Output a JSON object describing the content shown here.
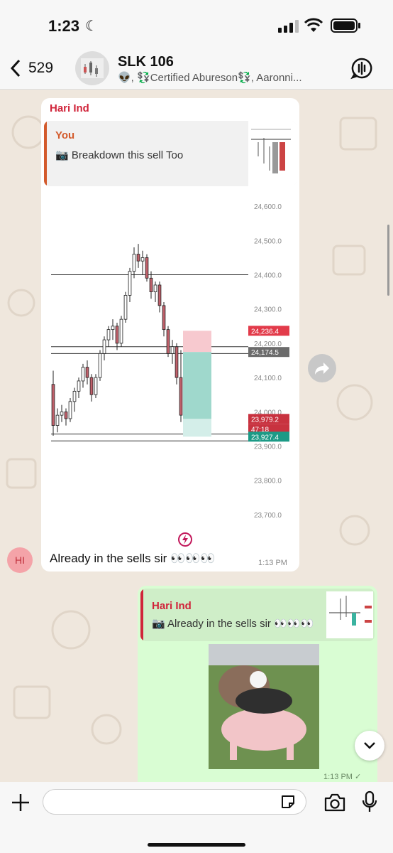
{
  "status_bar": {
    "time": "1:23",
    "moon_icon": "crescent-moon-icon"
  },
  "header": {
    "back_count": "529",
    "title": "SLK 106",
    "members": "👽, 💱Certified Abureson💱, Aaronni..."
  },
  "messages": {
    "incoming": {
      "sender": "Hari Ind",
      "quote_author": "You",
      "quote_text": "Breakdown this sell Too",
      "text": "Already in the sells sir 👀👀👀",
      "time": "1:13 PM",
      "avatar_initials": "HI"
    },
    "outgoing": {
      "quote_author": "Hari Ind",
      "quote_text": "Already in the sells sir 👀👀👀",
      "time": "1:13 PM ✓"
    }
  },
  "chart_data": {
    "type": "candlestick",
    "price_labels": [
      "24,600.0",
      "24,500.0",
      "24,400.0",
      "24,300.0",
      "24,200.0",
      "24,100.0",
      "24,000.0",
      "23,900.0",
      "23,800.0",
      "23,700.0"
    ],
    "markers": [
      {
        "label": "24,236.4",
        "color": "#e23b4a"
      },
      {
        "label": "24,174.5",
        "color": "#6b6b6b"
      },
      {
        "label": "23,979.2",
        "color": "#c8323f"
      },
      {
        "label": "47:18",
        "color": "#c8323f"
      },
      {
        "label": "23,927.4",
        "color": "#1c9a86"
      }
    ],
    "candles": [
      [
        24080,
        24120,
        23930,
        23960
      ],
      [
        23960,
        24010,
        23940,
        23990
      ],
      [
        23990,
        24020,
        23970,
        24000
      ],
      [
        24000,
        24010,
        23960,
        23980
      ],
      [
        23980,
        24040,
        23970,
        24030
      ],
      [
        24030,
        24070,
        24000,
        24060
      ],
      [
        24060,
        24100,
        24040,
        24090
      ],
      [
        24090,
        24140,
        24070,
        24130
      ],
      [
        24130,
        24150,
        24080,
        24100
      ],
      [
        24100,
        24110,
        24030,
        24050
      ],
      [
        24050,
        24110,
        24040,
        24100
      ],
      [
        24100,
        24180,
        24090,
        24170
      ],
      [
        24170,
        24220,
        24150,
        24210
      ],
      [
        24210,
        24250,
        24190,
        24240
      ],
      [
        24240,
        24270,
        24210,
        24250
      ],
      [
        24250,
        24260,
        24180,
        24200
      ],
      [
        24200,
        24280,
        24190,
        24270
      ],
      [
        24270,
        24350,
        24260,
        24340
      ],
      [
        24340,
        24420,
        24320,
        24410
      ],
      [
        24410,
        24480,
        24390,
        24460
      ],
      [
        24460,
        24490,
        24420,
        24440
      ],
      [
        24440,
        24470,
        24400,
        24450
      ],
      [
        24450,
        24460,
        24380,
        24390
      ],
      [
        24390,
        24410,
        24330,
        24350
      ],
      [
        24350,
        24380,
        24320,
        24370
      ],
      [
        24370,
        24380,
        24290,
        24310
      ],
      [
        24310,
        24320,
        24220,
        24240
      ],
      [
        24240,
        24250,
        24160,
        24170
      ],
      [
        24170,
        24210,
        24140,
        24190
      ],
      [
        24190,
        24200,
        24080,
        24100
      ],
      [
        24100,
        24180,
        23970,
        23990
      ]
    ],
    "lines": [
      24400,
      24190,
      24170,
      23915,
      23935
    ]
  },
  "input_bar": {
    "placeholder": ""
  }
}
